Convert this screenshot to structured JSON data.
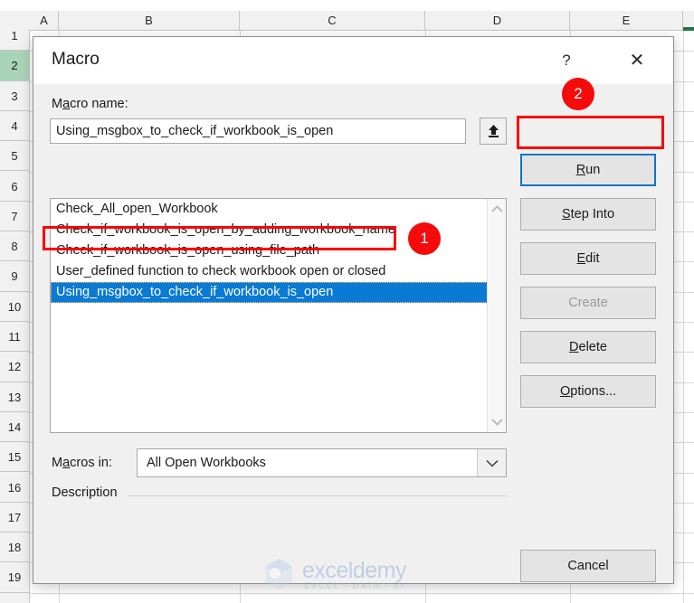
{
  "spreadsheet": {
    "columns": [
      "A",
      "B",
      "C",
      "D",
      "E"
    ],
    "rows": [
      "1",
      "2",
      "3",
      "4",
      "5",
      "6",
      "7",
      "8",
      "9",
      "10",
      "11",
      "12",
      "13",
      "14",
      "15",
      "16",
      "17",
      "18",
      "19"
    ],
    "active_row": "2",
    "active_row_color": "#a9d3b8"
  },
  "dialog": {
    "title": "Macro",
    "help_label": "?",
    "close_label": "✕",
    "macro_name_label_pre": "M",
    "macro_name_label_accel": "a",
    "macro_name_label_post": "cro name:",
    "macro_name_value": "Using_msgbox_to_check_if_workbook_is_open",
    "macro_name_upbutton_icon": "up-arrow-icon",
    "macro_list": [
      "Check_All_open_Workbook",
      "Check_if_workbook_is_open_by_adding_workbook_name",
      "Check_if_workbook_is_open_using_file_path",
      "User_defined function to check workbook open or closed",
      "Using_msgbox_to_check_if_workbook_is_open"
    ],
    "macro_list_selected_index": 4,
    "selection_color": "#0a7ad4",
    "scrollbar": {
      "up_icon": "chevron-up-icon",
      "down_icon": "chevron-down-icon"
    },
    "macros_in_label_pre": "M",
    "macros_in_label_accel": "a",
    "macros_in_label_post": "cros in:",
    "macros_in_value": "All Open Workbooks",
    "macros_in_dropdown_icon": "chevron-down-icon",
    "description_label": "Description",
    "buttons": [
      {
        "name": "run",
        "pre": "",
        "accel": "R",
        "post": "un",
        "disabled": false,
        "focused": true
      },
      {
        "name": "step-into",
        "pre": "",
        "accel": "S",
        "post": "tep Into",
        "disabled": false,
        "focused": false
      },
      {
        "name": "edit",
        "pre": "",
        "accel": "E",
        "post": "dit",
        "disabled": false,
        "focused": false
      },
      {
        "name": "create",
        "pre": "Create",
        "accel": "",
        "post": "",
        "disabled": true,
        "focused": false
      },
      {
        "name": "delete",
        "pre": "",
        "accel": "D",
        "post": "elete",
        "disabled": false,
        "focused": false
      },
      {
        "name": "options",
        "pre": "",
        "accel": "O",
        "post": "ptions...",
        "disabled": false,
        "focused": false
      }
    ],
    "cancel_label": "Cancel"
  },
  "annotations": {
    "badge_1": "1",
    "badge_2": "2",
    "badge_color": "#f50b0b",
    "rect_color": "#fa0505"
  },
  "watermark": {
    "name": "exceldemy",
    "tagline": "EXCEL - DATA - BI"
  }
}
